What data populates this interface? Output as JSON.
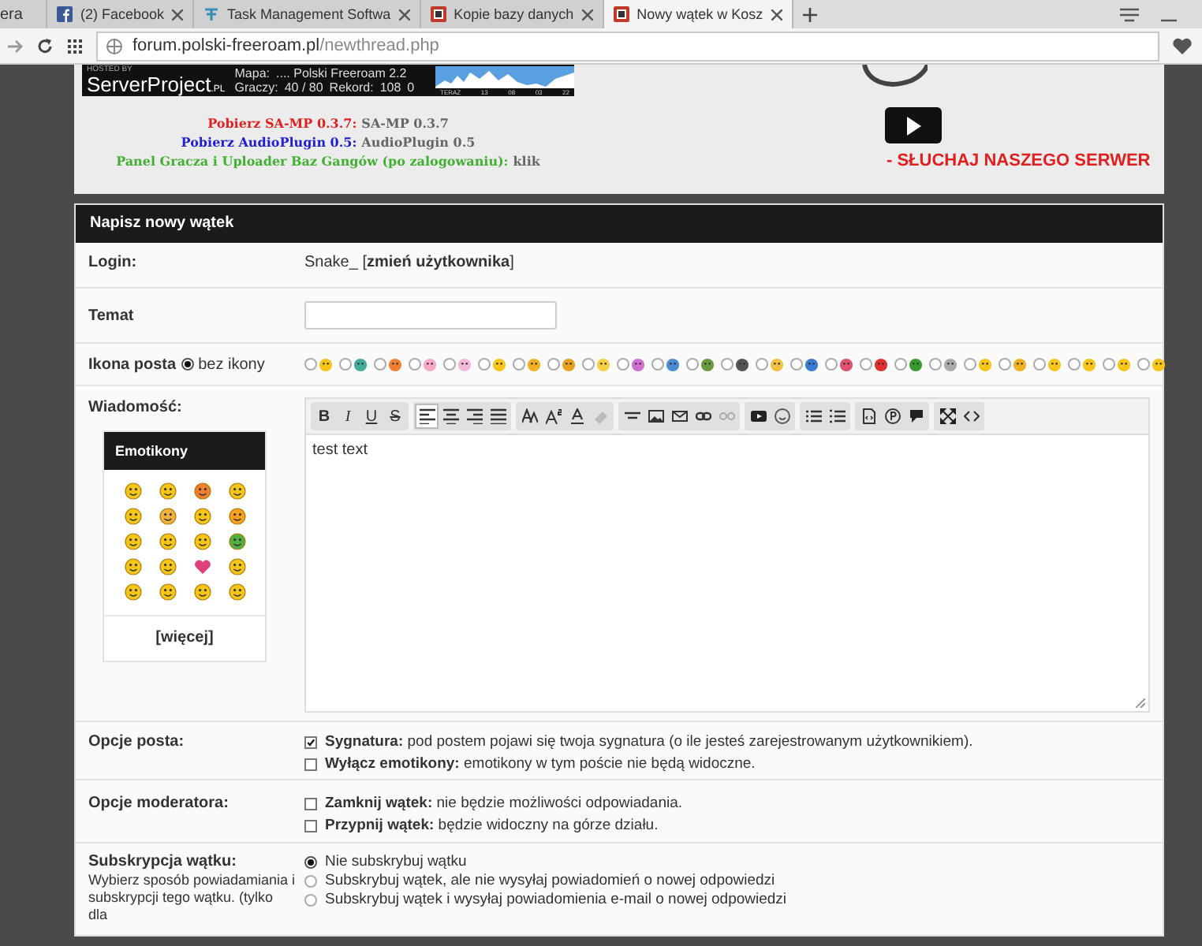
{
  "browser": {
    "tabs": [
      {
        "title": "era",
        "selected": false,
        "kind": "cut"
      },
      {
        "title": "(2) Facebook",
        "selected": false,
        "kind": "facebook"
      },
      {
        "title": "Task Management Softwa",
        "selected": false,
        "kind": "task"
      },
      {
        "title": "Kopie bazy danych",
        "selected": false,
        "kind": "forum"
      },
      {
        "title": "Nowy wątek w Kosz",
        "selected": true,
        "kind": "forum"
      }
    ],
    "address_host": "forum.polski-freeroam.pl",
    "address_path": "/newthread.php"
  },
  "banner": {
    "widget": {
      "hosted_by": "HOSTED BY",
      "brand": "ServerProject",
      "brand_suffix": ".PL",
      "map_label": "Mapa:",
      "map_value": ".... Polski Freeroam 2.2",
      "players_label": "Graczy:",
      "players_value": "40 / 80",
      "record_label": "Rekord:",
      "record_value": "108",
      "graph_zero": "0",
      "graph_ticks": [
        "TERAZ",
        "13",
        "08",
        "03",
        "22"
      ]
    },
    "links": [
      {
        "label": "Pobierz SA-MP 0.3.7:",
        "value": "SA-MP 0.3.7",
        "color": "#e02020"
      },
      {
        "label": "Pobierz AudioPlugin 0.5:",
        "value": "AudioPlugin 0.5",
        "color": "#2020d0"
      },
      {
        "label": "Panel Gracza i Uploader Baz Gangów (po zalogowaniu):",
        "value": "klik",
        "color": "#40b030"
      }
    ],
    "listen_text": "- SŁUCHAJ NASZEGO SERWER"
  },
  "form": {
    "title": "Napisz nowy wątek",
    "login": {
      "label": "Login:",
      "user": "Snake_",
      "change_open": "[",
      "change": "zmień użytkownika",
      "change_close": "]"
    },
    "subject": {
      "label": "Temat"
    },
    "post_icon": {
      "label": "Ikona posta",
      "none_label": "bez ikony",
      "none_selected": true,
      "icons": [
        {
          "selected": false
        },
        {
          "selected": false
        },
        {
          "selected": false
        },
        {
          "selected": false
        },
        {
          "selected": false
        },
        {
          "selected": false
        },
        {
          "selected": false
        },
        {
          "selected": false
        },
        {
          "selected": false
        },
        {
          "selected": false
        },
        {
          "selected": false
        },
        {
          "selected": false
        },
        {
          "selected": false
        },
        {
          "selected": false
        },
        {
          "selected": false
        },
        {
          "selected": false
        },
        {
          "selected": false
        },
        {
          "selected": false
        },
        {
          "selected": false
        },
        {
          "selected": false
        },
        {
          "selected": false
        },
        {
          "selected": false
        },
        {
          "selected": false
        },
        {
          "selected": false
        },
        {
          "selected": false
        }
      ]
    },
    "message": {
      "label": "Wiadomość:",
      "emoticons_title": "Emotikony",
      "more": "[więcej]",
      "text": "test text",
      "toolbar": [
        [
          {
            "kind": "bold",
            "label": "B",
            "selected": false
          },
          {
            "kind": "italic",
            "label": "I",
            "selected": false
          },
          {
            "kind": "underline",
            "label": "U",
            "selected": false
          },
          {
            "kind": "strike",
            "label": "S",
            "selected": false
          }
        ],
        [
          {
            "kind": "align-left",
            "selected": true
          },
          {
            "kind": "align-center",
            "selected": false
          },
          {
            "kind": "align-right",
            "selected": false
          },
          {
            "kind": "justify",
            "selected": false
          }
        ],
        [
          {
            "kind": "font",
            "selected": false
          },
          {
            "kind": "size",
            "selected": false
          },
          {
            "kind": "color",
            "selected": false
          },
          {
            "kind": "eraser",
            "selected": false
          }
        ],
        [
          {
            "kind": "rule",
            "selected": false
          },
          {
            "kind": "image",
            "selected": false
          },
          {
            "kind": "email",
            "selected": false
          },
          {
            "kind": "link",
            "selected": false
          },
          {
            "kind": "unlink",
            "selected": false
          }
        ],
        [
          {
            "kind": "video",
            "selected": false
          },
          {
            "kind": "smiley",
            "selected": false
          }
        ],
        [
          {
            "kind": "bullets",
            "selected": false
          },
          {
            "kind": "numbers",
            "selected": false
          }
        ],
        [
          {
            "kind": "code",
            "selected": false
          },
          {
            "kind": "php",
            "selected": false
          },
          {
            "kind": "quote",
            "selected": false
          }
        ],
        [
          {
            "kind": "maximize",
            "selected": false
          },
          {
            "kind": "source",
            "selected": false
          }
        ]
      ]
    },
    "post_options": {
      "label": "Opcje posta:",
      "items": [
        {
          "title": "Sygnatura:",
          "text": "pod postem pojawi się twoja sygnatura (o ile jesteś zarejestrowanym użytkownikiem).",
          "checked": true
        },
        {
          "title": "Wyłącz emotikony:",
          "text": "emotikony w tym poście nie będą widoczne.",
          "checked": false
        }
      ]
    },
    "mod_options": {
      "label": "Opcje moderatora:",
      "items": [
        {
          "title": "Zamknij wątek:",
          "text": "nie będzie możliwości odpowiadania.",
          "checked": false
        },
        {
          "title": "Przypnij wątek:",
          "text": "będzie widoczny na górze działu.",
          "checked": false
        }
      ]
    },
    "subscription": {
      "label": "Subskrypcja wątku:",
      "description": "Wybierz sposób powiadamiania i subskrypcji tego wątku. (tylko dla",
      "options": [
        {
          "label": "Nie subskrybuj wątku",
          "selected": true
        },
        {
          "label": "Subskrybuj wątek, ale nie wysyłaj powiadomień o nowej odpowiedzi",
          "selected": false
        },
        {
          "label": "Subskrybuj wątek i wysyłaj powiadomienia e-mail o nowej odpowiedzi",
          "selected": false
        }
      ]
    }
  }
}
